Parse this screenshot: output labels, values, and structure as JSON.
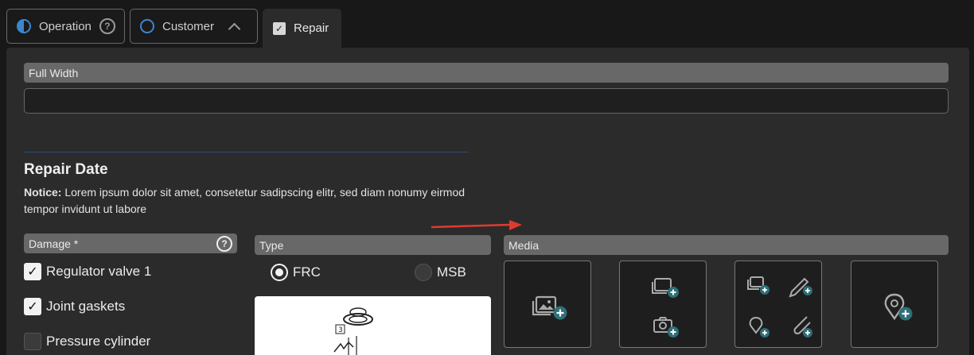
{
  "tabs": [
    {
      "label": "Operation",
      "icon": "half-circle-icon"
    },
    {
      "label": "Customer",
      "icon": "circle-icon"
    },
    {
      "label": "Repair",
      "icon": "checkbox-icon"
    }
  ],
  "full_width": {
    "label": "Full Width",
    "value": ""
  },
  "section": {
    "title": "Repair Date",
    "notice_label": "Notice:",
    "notice_text": " Lorem ipsum dolor sit amet, consetetur sadipscing elitr, sed diam nonumy eirmod tempor invidunt ut labore"
  },
  "damage": {
    "label": "Damage *",
    "items": [
      {
        "label": "Regulator valve 1",
        "checked": true
      },
      {
        "label": "Joint gaskets",
        "checked": true
      },
      {
        "label": "Pressure cylinder",
        "checked": false
      }
    ]
  },
  "type": {
    "label": "Type",
    "options": [
      {
        "label": "FRC",
        "selected": true
      },
      {
        "label": "MSB",
        "selected": false
      }
    ]
  },
  "media": {
    "label": "Media",
    "tiles": [
      "add-image",
      "add-image-or-camera",
      "add-image-pen-location-attachment",
      "add-location"
    ]
  },
  "colors": {
    "accent": "#3c86cf",
    "add_badge": "#2e6f78",
    "arrow": "#e03a2f"
  }
}
